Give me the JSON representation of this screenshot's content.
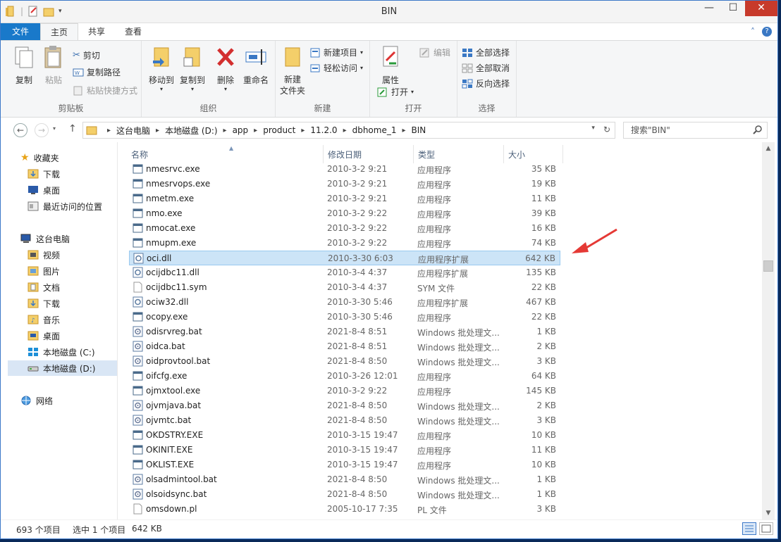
{
  "window": {
    "title": "BIN"
  },
  "tabs": {
    "file": "文件",
    "home": "主页",
    "share": "共享",
    "view": "查看"
  },
  "ribbon": {
    "clipboard": {
      "name": "剪贴板",
      "copy": "复制",
      "paste": "粘贴",
      "cut": "剪切",
      "copy_path": "复制路径",
      "paste_shortcut": "粘贴快捷方式"
    },
    "organize": {
      "name": "组织",
      "move_to": "移动到",
      "copy_to": "复制到",
      "delete": "删除",
      "rename": "重命名"
    },
    "new": {
      "name": "新建",
      "new_folder": "新建\n文件夹",
      "new_item": "新建项目",
      "easy_access": "轻松访问"
    },
    "open": {
      "name": "打开",
      "properties": "属性",
      "open": "打开",
      "edit": "编辑"
    },
    "select": {
      "name": "选择",
      "select_all": "全部选择",
      "select_none": "全部取消",
      "invert": "反向选择"
    }
  },
  "address": {
    "crumbs": [
      "这台电脑",
      "本地磁盘 (D:)",
      "app",
      "product",
      "11.2.0",
      "dbhome_1",
      "BIN"
    ],
    "search_placeholder": "搜索\"BIN\""
  },
  "nav": {
    "favorites": "收藏夹",
    "fav_items": [
      "下载",
      "桌面",
      "最近访问的位置"
    ],
    "this_pc": "这台电脑",
    "pc_items": [
      "视频",
      "图片",
      "文档",
      "下载",
      "音乐",
      "桌面",
      "本地磁盘 (C:)",
      "本地磁盘 (D:)"
    ],
    "network": "网络"
  },
  "columns": {
    "name": "名称",
    "date": "修改日期",
    "type": "类型",
    "size": "大小"
  },
  "files": [
    {
      "name": "nmesrvc.exe",
      "date": "2010-3-2 9:21",
      "type": "应用程序",
      "size": "35 KB",
      "icon": "exe"
    },
    {
      "name": "nmesrvops.exe",
      "date": "2010-3-2 9:21",
      "type": "应用程序",
      "size": "19 KB",
      "icon": "exe"
    },
    {
      "name": "nmetm.exe",
      "date": "2010-3-2 9:21",
      "type": "应用程序",
      "size": "11 KB",
      "icon": "exe"
    },
    {
      "name": "nmo.exe",
      "date": "2010-3-2 9:22",
      "type": "应用程序",
      "size": "39 KB",
      "icon": "exe"
    },
    {
      "name": "nmocat.exe",
      "date": "2010-3-2 9:22",
      "type": "应用程序",
      "size": "16 KB",
      "icon": "exe"
    },
    {
      "name": "nmupm.exe",
      "date": "2010-3-2 9:22",
      "type": "应用程序",
      "size": "74 KB",
      "icon": "exe"
    },
    {
      "name": "oci.dll",
      "date": "2010-3-30 6:03",
      "type": "应用程序扩展",
      "size": "642 KB",
      "icon": "dll",
      "selected": true
    },
    {
      "name": "ocijdbc11.dll",
      "date": "2010-3-4 4:37",
      "type": "应用程序扩展",
      "size": "135 KB",
      "icon": "dll"
    },
    {
      "name": "ocijdbc11.sym",
      "date": "2010-3-4 4:37",
      "type": "SYM 文件",
      "size": "22 KB",
      "icon": "file"
    },
    {
      "name": "ociw32.dll",
      "date": "2010-3-30 5:46",
      "type": "应用程序扩展",
      "size": "467 KB",
      "icon": "dll"
    },
    {
      "name": "ocopy.exe",
      "date": "2010-3-30 5:46",
      "type": "应用程序",
      "size": "22 KB",
      "icon": "exe"
    },
    {
      "name": "odisrvreg.bat",
      "date": "2021-8-4 8:51",
      "type": "Windows 批处理文...",
      "size": "1 KB",
      "icon": "bat"
    },
    {
      "name": "oidca.bat",
      "date": "2021-8-4 8:51",
      "type": "Windows 批处理文...",
      "size": "2 KB",
      "icon": "bat"
    },
    {
      "name": "oidprovtool.bat",
      "date": "2021-8-4 8:50",
      "type": "Windows 批处理文...",
      "size": "3 KB",
      "icon": "bat"
    },
    {
      "name": "oifcfg.exe",
      "date": "2010-3-26 12:01",
      "type": "应用程序",
      "size": "64 KB",
      "icon": "exe"
    },
    {
      "name": "ojmxtool.exe",
      "date": "2010-3-2 9:22",
      "type": "应用程序",
      "size": "145 KB",
      "icon": "exe"
    },
    {
      "name": "ojvmjava.bat",
      "date": "2021-8-4 8:50",
      "type": "Windows 批处理文...",
      "size": "2 KB",
      "icon": "bat"
    },
    {
      "name": "ojvmtc.bat",
      "date": "2021-8-4 8:50",
      "type": "Windows 批处理文...",
      "size": "3 KB",
      "icon": "bat"
    },
    {
      "name": "OKDSTRY.EXE",
      "date": "2010-3-15 19:47",
      "type": "应用程序",
      "size": "10 KB",
      "icon": "exe"
    },
    {
      "name": "OKINIT.EXE",
      "date": "2010-3-15 19:47",
      "type": "应用程序",
      "size": "11 KB",
      "icon": "exe"
    },
    {
      "name": "OKLIST.EXE",
      "date": "2010-3-15 19:47",
      "type": "应用程序",
      "size": "10 KB",
      "icon": "exe"
    },
    {
      "name": "olsadmintool.bat",
      "date": "2021-8-4 8:50",
      "type": "Windows 批处理文...",
      "size": "1 KB",
      "icon": "bat"
    },
    {
      "name": "olsoidsync.bat",
      "date": "2021-8-4 8:50",
      "type": "Windows 批处理文...",
      "size": "1 KB",
      "icon": "bat"
    },
    {
      "name": "omsdown.pl",
      "date": "2005-10-17 7:35",
      "type": "PL 文件",
      "size": "3 KB",
      "icon": "file"
    }
  ],
  "status": {
    "count": "693 个项目",
    "selected": "选中 1 个项目",
    "sel_size": "642 KB"
  },
  "colors": {
    "accent": "#1979ca",
    "selection": "#cce4f7",
    "arrow": "#e53935"
  }
}
